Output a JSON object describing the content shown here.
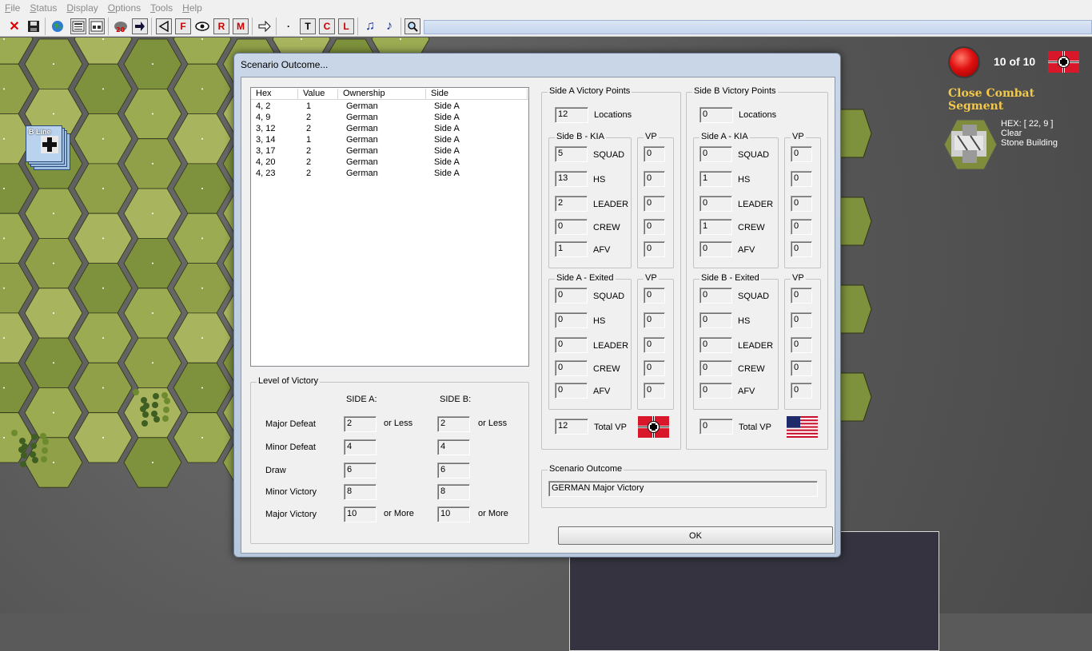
{
  "menu": [
    "File",
    "Status",
    "Display",
    "Options",
    "Tools",
    "Help"
  ],
  "toolbar": {
    "letters": [
      "F",
      "R",
      "M",
      "T",
      "C",
      "L"
    ],
    "icons": [
      "close-icon",
      "save-icon",
      "globe-icon",
      "panel-icon",
      "panel2-icon",
      "smoke-icon",
      "arrow-right-icon",
      "triangle-left-icon",
      "eye-icon",
      "arrow-outline-icon",
      "dot-icon",
      "music-icon",
      "music2-icon",
      "zoom-icon"
    ]
  },
  "hud": {
    "turn": "10 of 10",
    "phase": "Close Combat Segment",
    "hex_info": {
      "coords": "HEX: [ 22, 9 ]",
      "terrain": "Clear",
      "feature": "Stone Building"
    }
  },
  "unit_counter": {
    "label": "B Line"
  },
  "dialog": {
    "title": "Scenario Outcome...",
    "hex_table": {
      "columns": [
        "Hex",
        "Value",
        "Ownership",
        "Side"
      ],
      "rows": [
        [
          "4, 2",
          "1",
          "German",
          "Side A"
        ],
        [
          "4, 9",
          "2",
          "German",
          "Side A"
        ],
        [
          "3, 12",
          "2",
          "German",
          "Side A"
        ],
        [
          "3, 14",
          "1",
          "German",
          "Side A"
        ],
        [
          "3, 17",
          "2",
          "German",
          "Side A"
        ],
        [
          "4, 20",
          "2",
          "German",
          "Side A"
        ],
        [
          "4, 23",
          "2",
          "German",
          "Side A"
        ]
      ]
    },
    "level_of_victory": {
      "title": "Level of Victory",
      "side_a_header": "SIDE A:",
      "side_b_header": "SIDE B:",
      "rows": [
        {
          "label": "Major Defeat",
          "a": "2",
          "b": "2",
          "suffix": "or Less"
        },
        {
          "label": "Minor Defeat",
          "a": "4",
          "b": "4",
          "suffix": ""
        },
        {
          "label": "Draw",
          "a": "6",
          "b": "6",
          "suffix": ""
        },
        {
          "label": "Minor Victory",
          "a": "8",
          "b": "8",
          "suffix": ""
        },
        {
          "label": "Major Victory",
          "a": "10",
          "b": "10",
          "suffix": "or More"
        }
      ]
    },
    "side_a": {
      "title": "Side A Victory Points",
      "locations_value": "12",
      "locations_label": "Locations",
      "kia_title": "Side B - KIA",
      "exited_title": "Side A - Exited",
      "vp_title": "VP",
      "kia": [
        {
          "label": "SQUAD",
          "count": "5",
          "vp": "0"
        },
        {
          "label": "HS",
          "count": "13",
          "vp": "0"
        },
        {
          "label": "LEADER",
          "count": "2",
          "vp": "0"
        },
        {
          "label": "CREW",
          "count": "0",
          "vp": "0"
        },
        {
          "label": "AFV",
          "count": "1",
          "vp": "0"
        }
      ],
      "exited": [
        {
          "label": "SQUAD",
          "count": "0",
          "vp": "0"
        },
        {
          "label": "HS",
          "count": "0",
          "vp": "0"
        },
        {
          "label": "LEADER",
          "count": "0",
          "vp": "0"
        },
        {
          "label": "CREW",
          "count": "0",
          "vp": "0"
        },
        {
          "label": "AFV",
          "count": "0",
          "vp": "0"
        }
      ],
      "total_value": "12",
      "total_label": "Total VP"
    },
    "side_b": {
      "title": "Side B Victory Points",
      "locations_value": "0",
      "locations_label": "Locations",
      "kia_title": "Side A - KIA",
      "exited_title": "Side B - Exited",
      "vp_title": "VP",
      "kia": [
        {
          "label": "SQUAD",
          "count": "0",
          "vp": "0"
        },
        {
          "label": "HS",
          "count": "1",
          "vp": "0"
        },
        {
          "label": "LEADER",
          "count": "0",
          "vp": "0"
        },
        {
          "label": "CREW",
          "count": "1",
          "vp": "0"
        },
        {
          "label": "AFV",
          "count": "0",
          "vp": "0"
        }
      ],
      "exited": [
        {
          "label": "SQUAD",
          "count": "0",
          "vp": "0"
        },
        {
          "label": "HS",
          "count": "0",
          "vp": "0"
        },
        {
          "label": "LEADER",
          "count": "0",
          "vp": "0"
        },
        {
          "label": "CREW",
          "count": "0",
          "vp": "0"
        },
        {
          "label": "AFV",
          "count": "0",
          "vp": "0"
        }
      ],
      "total_value": "0",
      "total_label": "Total VP"
    },
    "outcome": {
      "title": "Scenario Outcome",
      "value": "GERMAN Major Victory"
    },
    "ok_label": "OK"
  },
  "colors": {
    "grass": "#9aab52",
    "grass_dark": "#7e913c",
    "dialog_frame": "#c9d6e8",
    "hud_phase": "#f2c84a"
  }
}
